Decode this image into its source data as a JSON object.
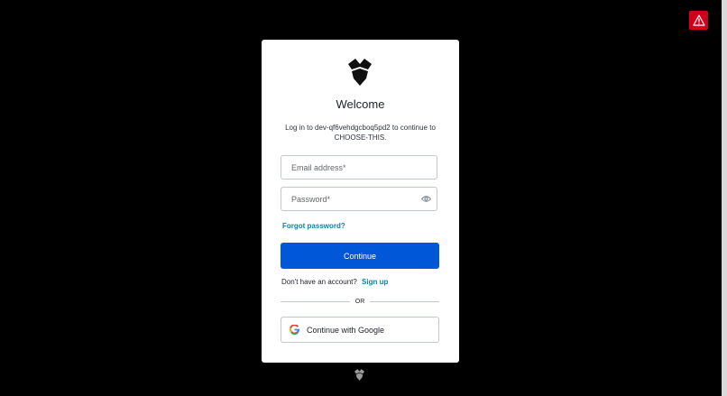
{
  "colors": {
    "background": "#000000",
    "card": "#ffffff",
    "primary_button": "#0057d8",
    "link": "#0a84ae",
    "alert": "#d0021b"
  },
  "alert": {
    "icon": "warning-icon"
  },
  "card": {
    "logo_icon": "shield-logo-icon",
    "title": "Welcome",
    "subtitle": "Log in to dev-qf6vehdgcboq5pd2 to continue to CHOOSE-THIS.",
    "email": {
      "placeholder": "Email address*",
      "value": ""
    },
    "password": {
      "placeholder": "Password*",
      "value": "",
      "toggle_icon": "eye-icon"
    },
    "forgot_password": "Forgot password?",
    "continue_label": "Continue",
    "signup_prompt": "Don't have an account?",
    "signup_link": "Sign up",
    "divider_text": "OR",
    "google_label": "Continue with Google",
    "google_icon": "google-icon"
  },
  "footer": {
    "logo_icon": "shield-logo-icon"
  }
}
